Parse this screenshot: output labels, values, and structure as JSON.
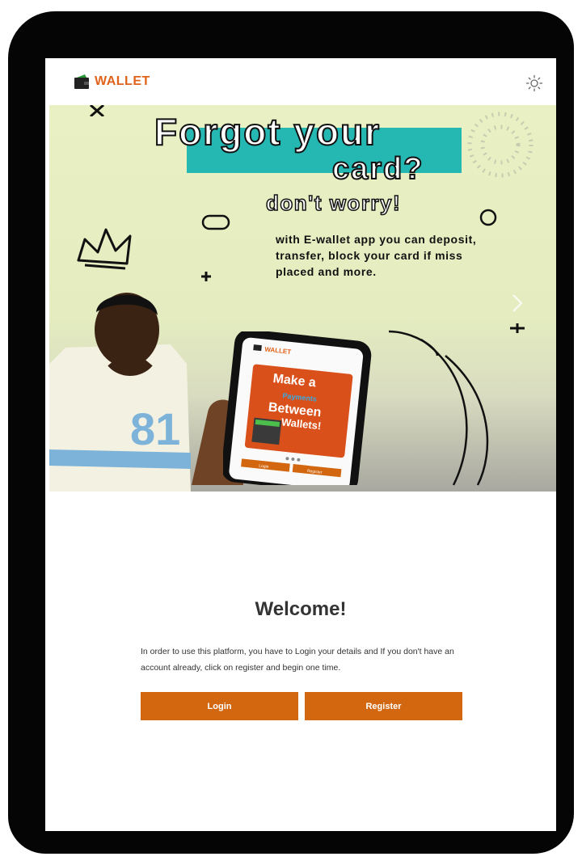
{
  "header": {
    "brand": "WALLET",
    "brand_color": "#e0621b",
    "logo_icon": "wallet-icon",
    "theme_icon": "sun-icon"
  },
  "hero": {
    "headline_line1": "Forgot your",
    "headline_line2": "card?",
    "subheadline": "don't worry!",
    "body": "with E-wallet app you can deposit, transfer, block your card if miss placed and more.",
    "next_icon": "chevron-right-icon",
    "phone": {
      "brand": "WALLET",
      "card_text_1": "Make a",
      "card_text_2": "Payments",
      "card_text_3": "Between",
      "card_text_4": "Wallets!",
      "btn_1": "Login",
      "btn_2": "Register"
    }
  },
  "welcome": {
    "title": "Welcome!",
    "text": "In order to use this platform, you have to Login your details and If you don't have an account already, click on register and begin one time."
  },
  "buttons": {
    "login": "Login",
    "register": "Register",
    "color": "#d2670f"
  }
}
